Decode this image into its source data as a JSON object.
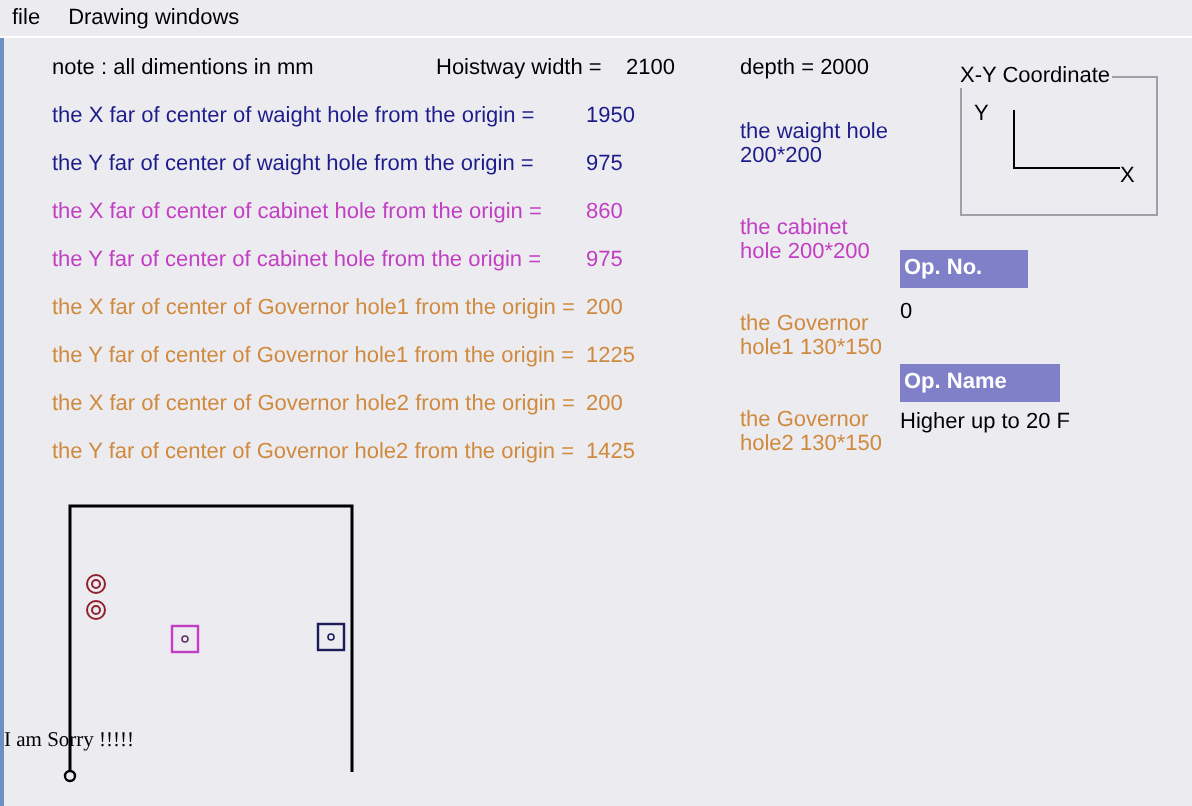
{
  "menu": [
    "file",
    "Drawing windows"
  ],
  "note": "note : all dimentions in mm",
  "hoistway": {
    "label": "Hoistway width =",
    "value": "2100"
  },
  "depth": "depth = 2000",
  "rows": [
    {
      "label": "the X far of center of waight hole from the origin =",
      "value": "1950",
      "color": "#1c1c8a"
    },
    {
      "label": "the Y far of center of waight hole from the origin =",
      "value": "975",
      "color": "#1c1c8a"
    },
    {
      "label": "the X far of center of cabinet hole from the origin =",
      "value": "860",
      "color": "#c23ec2"
    },
    {
      "label": "the Y far of center of cabinet hole from the origin =",
      "value": "975",
      "color": "#c23ec2"
    },
    {
      "label": "the X far of center of  Governor  hole1 from the origin =",
      "value": "200",
      "color": "#d08a3e"
    },
    {
      "label": "the Y far of center of  Governor  hole1 from the origin =",
      "value": "1225",
      "color": "#d08a3e"
    },
    {
      "label": "the X far of center of  Governor  hole2 from the origin =",
      "value": "200",
      "color": "#d08a3e"
    },
    {
      "label": "the Y far of center of  Governor  hole2 from the origin =",
      "value": "1425",
      "color": "#d08a3e"
    }
  ],
  "hole_notes": [
    {
      "lines": [
        "the waight hole",
        "200*200"
      ],
      "color": "#1c1c8a"
    },
    {
      "lines": [
        "the cabinet",
        "hole 200*200"
      ],
      "color": "#c23ec2"
    },
    {
      "lines": [
        "the Governor",
        "hole1  130*150"
      ],
      "color": "#d08a3e"
    },
    {
      "lines": [
        "the Governor",
        "hole2 130*150"
      ],
      "color": "#d08a3e"
    }
  ],
  "coordinate_box": {
    "title": "X-Y Coordinate",
    "y_label": "Y",
    "x_label": "X"
  },
  "op_no": {
    "header": "Op. No.",
    "value": "0"
  },
  "op_name": {
    "header": "Op. Name",
    "value": "Higher up to 20 F"
  },
  "drawing": {
    "message": "I am Sorry !!!!!"
  }
}
